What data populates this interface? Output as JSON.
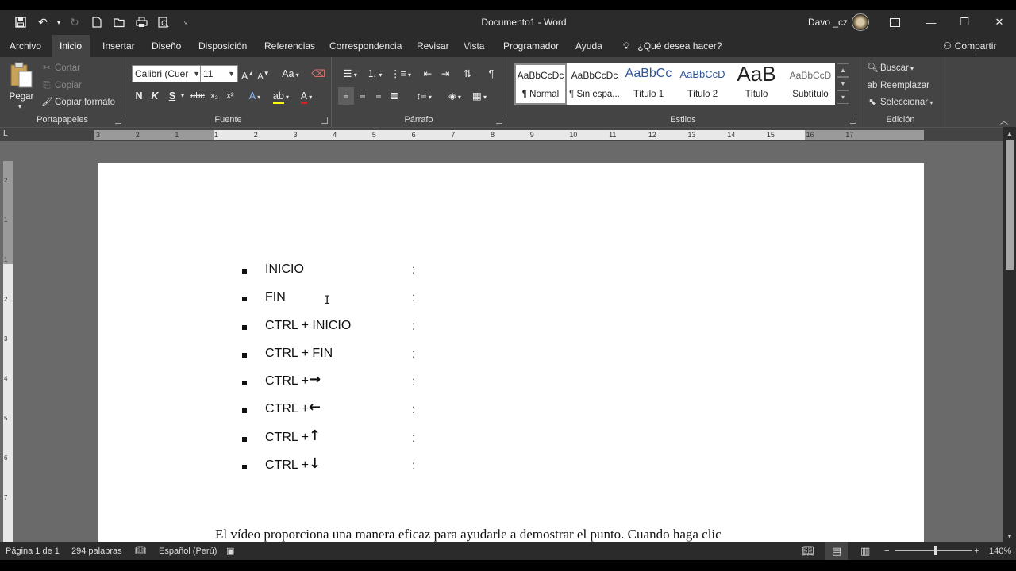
{
  "window": {
    "title": "Documento1  -  Word",
    "user": "Davo _cz"
  },
  "quick_access": [
    "save-icon",
    "undo-icon",
    "redo-icon",
    "new-doc-icon",
    "open-icon",
    "print-icon",
    "print-preview-icon",
    "customize-icon"
  ],
  "tabs": [
    "Archivo",
    "Inicio",
    "Insertar",
    "Diseño",
    "Disposición",
    "Referencias",
    "Correspondencia",
    "Revisar",
    "Vista",
    "Programador",
    "Ayuda"
  ],
  "active_tab": "Inicio",
  "tell_me": "¿Qué desea hacer?",
  "share": "Compartir",
  "ribbon": {
    "clipboard": {
      "label": "Portapapeles",
      "paste": "Pegar",
      "cut": "Cortar",
      "copy": "Copiar",
      "format_painter": "Copiar formato"
    },
    "font": {
      "label": "Fuente",
      "font_name": "Calibri (Cuer",
      "font_size": "11",
      "bold": "N",
      "italic": "K",
      "underline": "S",
      "strike": "abc",
      "subscript": "x₂",
      "superscript": "x²",
      "case": "Aa"
    },
    "paragraph": {
      "label": "Párrafo"
    },
    "styles": {
      "label": "Estilos",
      "items": [
        {
          "preview": "AaBbCcDc",
          "name": "¶ Normal"
        },
        {
          "preview": "AaBbCcDc",
          "name": "¶ Sin espa..."
        },
        {
          "preview": "AaBbCc",
          "name": "Título 1"
        },
        {
          "preview": "AaBbCcD",
          "name": "Título 2"
        },
        {
          "preview": "AaB",
          "name": "Título"
        },
        {
          "preview": "AaBbCcD",
          "name": "Subtítulo"
        }
      ]
    },
    "editing": {
      "label": "Edición",
      "find": "Buscar",
      "replace": "Reemplazar",
      "select": "Seleccionar"
    }
  },
  "ruler": {
    "h_numbers": [
      "3",
      "2",
      "1",
      "1",
      "2",
      "3",
      "4",
      "5",
      "6",
      "7",
      "8",
      "9",
      "10",
      "11",
      "12",
      "13",
      "14",
      "15",
      "16",
      "17"
    ],
    "v_numbers": [
      "2",
      "1",
      "1",
      "2",
      "3",
      "4",
      "5",
      "6",
      "7"
    ]
  },
  "document": {
    "items": [
      {
        "key": "INICIO",
        "arrow": ""
      },
      {
        "key": "FIN",
        "arrow": ""
      },
      {
        "key": "CTRL + INICIO",
        "arrow": ""
      },
      {
        "key": "CTRL + FIN",
        "arrow": ""
      },
      {
        "key": "CTRL + ",
        "arrow": "→"
      },
      {
        "key": "CTRL + ",
        "arrow": "←"
      },
      {
        "key": "CTRL + ",
        "arrow": "↑"
      },
      {
        "key": "CTRL + ",
        "arrow": "↓"
      }
    ],
    "colon": ":",
    "paragraph": "El vídeo proporciona una manera eficaz para ayudarle a demostrar el punto. Cuando haga clic"
  },
  "status": {
    "page": "Página 1 de 1",
    "words": "294 palabras",
    "language": "Español (Perú)",
    "zoom": "140%"
  }
}
